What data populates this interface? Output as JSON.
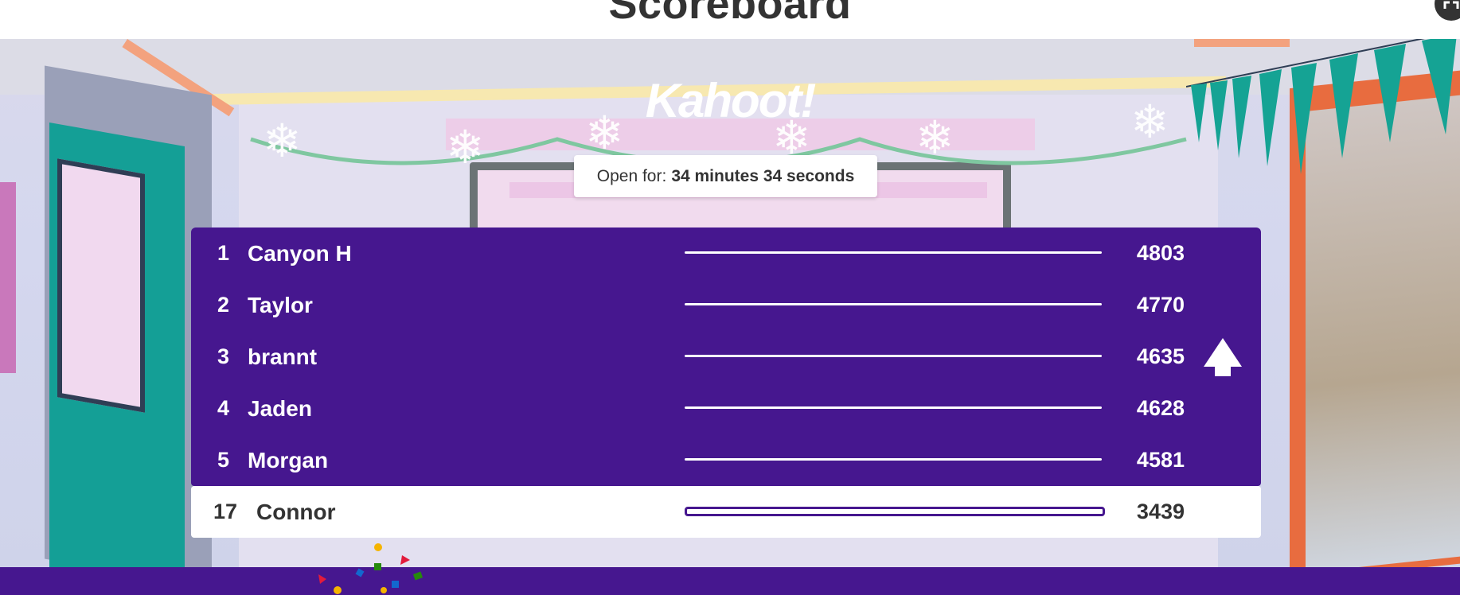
{
  "header": {
    "title": "Scoreboard",
    "fullscreen_icon": "fullscreen-icon"
  },
  "logo": {
    "text": "Kahoot!"
  },
  "open_for": {
    "label": "Open for:",
    "value": "34 minutes 34 seconds"
  },
  "scoreboard": {
    "rows": [
      {
        "rank": "1",
        "name": "Canyon H",
        "score": "4803",
        "progress": 1.0
      },
      {
        "rank": "2",
        "name": "Taylor",
        "score": "4770",
        "progress": 1.0
      },
      {
        "rank": "3",
        "name": "brannt",
        "score": "4635",
        "progress": 1.0
      },
      {
        "rank": "4",
        "name": "Jaden",
        "score": "4628",
        "progress": 1.0
      },
      {
        "rank": "5",
        "name": "Morgan",
        "score": "4581",
        "progress": 1.0
      }
    ],
    "current_player": {
      "rank": "17",
      "name": "Connor",
      "score": "3439",
      "progress": 1.0
    },
    "movement_icon": "arrow-up-icon"
  },
  "colors": {
    "brand_purple": "#46178f",
    "text_dark": "#333333"
  }
}
